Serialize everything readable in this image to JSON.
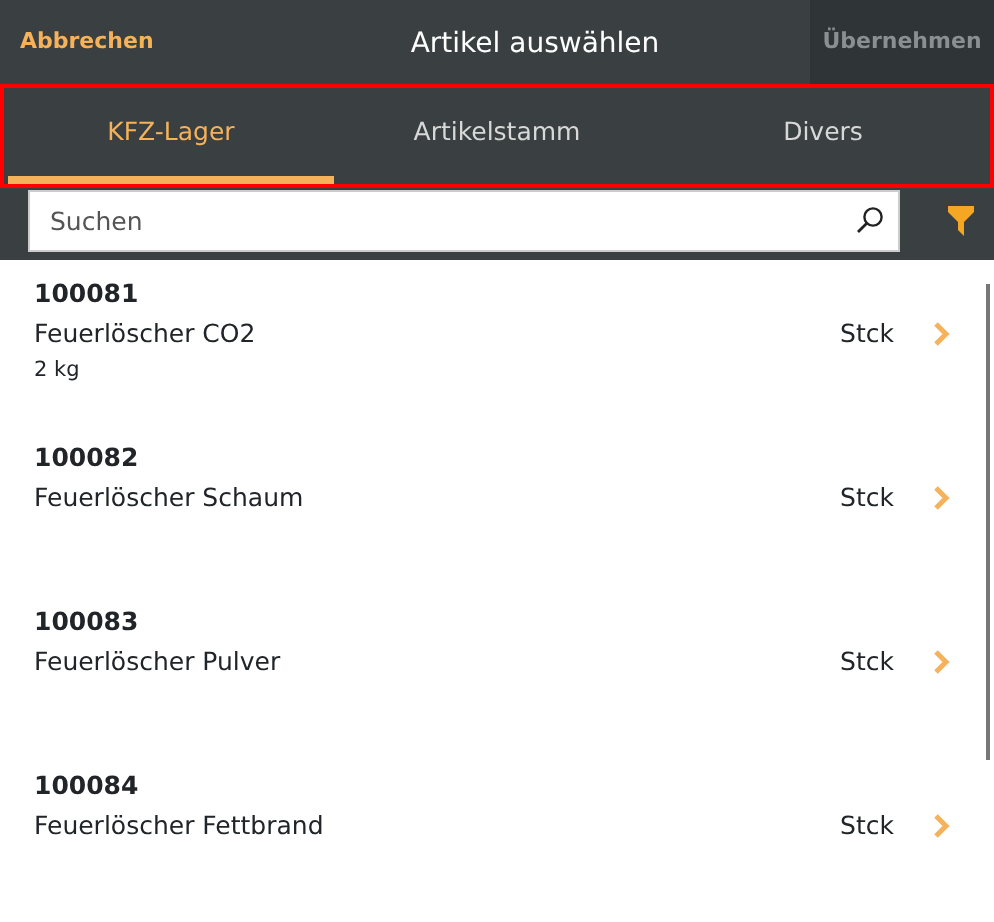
{
  "header": {
    "cancel": "Abbrechen",
    "title": "Artikel auswählen",
    "confirm": {
      "label": "Übernehmen",
      "disabled": true
    }
  },
  "tabs_highlighted": true,
  "tabs": [
    {
      "label": "KFZ-Lager",
      "selected": true
    },
    {
      "label": "Artikelstamm",
      "selected": false
    },
    {
      "label": "Divers",
      "selected": false
    }
  ],
  "search": {
    "placeholder": "Suchen"
  },
  "items": [
    {
      "number": "100081",
      "name": "Feuerlöscher CO2",
      "detail": "2 kg",
      "unit": "Stck"
    },
    {
      "number": "100082",
      "name": "Feuerlöscher Schaum",
      "unit": "Stck"
    },
    {
      "number": "100083",
      "name": "Feuerlöscher Pulver",
      "unit": "Stck"
    },
    {
      "number": "100084",
      "name": "Feuerlöscher Fettbrand",
      "unit": "Stck"
    }
  ]
}
